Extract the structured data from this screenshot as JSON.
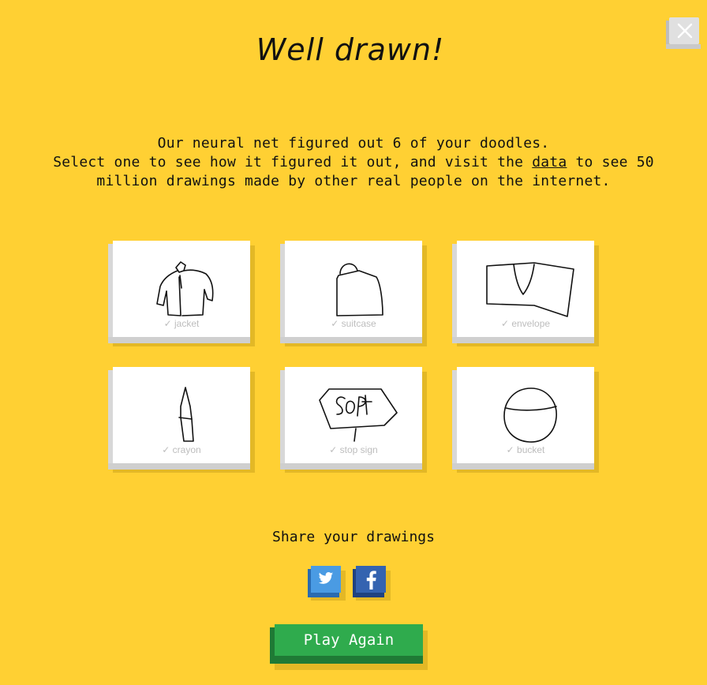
{
  "header": {
    "title": "Well drawn!"
  },
  "intro": {
    "line1": "Our neural net figured out 6 of your doodles.",
    "line2_pre": "Select one to see how it figured it out, and visit the",
    "link": "data",
    "line2_post": "to see 50",
    "line3": "million drawings made by other real people on the internet."
  },
  "doodles": [
    {
      "label": "✓ jacket",
      "icon": "jacket-doodle"
    },
    {
      "label": "✓ suitcase",
      "icon": "suitcase-doodle"
    },
    {
      "label": "✓ envelope",
      "icon": "envelope-doodle"
    },
    {
      "label": "✓ crayon",
      "icon": "crayon-doodle"
    },
    {
      "label": "✓ stop sign",
      "icon": "stop-sign-doodle"
    },
    {
      "label": "✓ bucket",
      "icon": "bucket-doodle"
    }
  ],
  "share": {
    "label": "Share your drawings",
    "icons": [
      "twitter-icon",
      "facebook-icon"
    ]
  },
  "play_again": {
    "label": "Play Again"
  },
  "colors": {
    "background": "#ffd033",
    "play_button": "#2fab4d",
    "twitter": "#4a9be3",
    "facebook": "#3463b0"
  }
}
